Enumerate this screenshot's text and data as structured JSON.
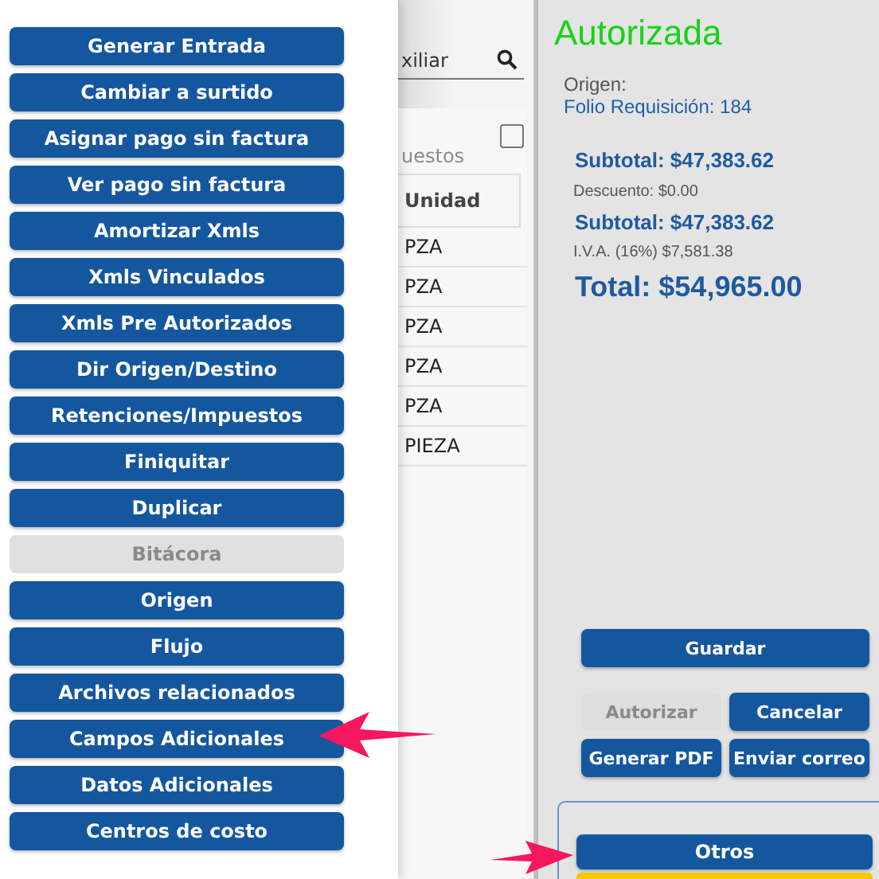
{
  "menu": [
    {
      "label": "Generar Entrada",
      "disabled": false
    },
    {
      "label": "Cambiar a surtido",
      "disabled": false
    },
    {
      "label": "Asignar pago sin factura",
      "disabled": false
    },
    {
      "label": "Ver pago sin factura",
      "disabled": false
    },
    {
      "label": "Amortizar Xmls",
      "disabled": false
    },
    {
      "label": "Xmls Vinculados",
      "disabled": false
    },
    {
      "label": "Xmls Pre Autorizados",
      "disabled": false
    },
    {
      "label": "Dir Origen/Destino",
      "disabled": false
    },
    {
      "label": "Retenciones/Impuestos",
      "disabled": false
    },
    {
      "label": "Finiquitar",
      "disabled": false
    },
    {
      "label": "Duplicar",
      "disabled": false
    },
    {
      "label": "Bitácora",
      "disabled": true
    },
    {
      "label": "Origen",
      "disabled": false
    },
    {
      "label": "Flujo",
      "disabled": false
    },
    {
      "label": "Archivos relacionados",
      "disabled": false
    },
    {
      "label": "Campos Adicionales",
      "disabled": false
    },
    {
      "label": "Datos Adicionales",
      "disabled": false
    },
    {
      "label": "Centros de costo",
      "disabled": false
    }
  ],
  "search": {
    "value": "xiliar"
  },
  "table": {
    "section_label": "uestos",
    "checked": false,
    "columns": [
      "Unidad"
    ],
    "rows": [
      [
        "PZA"
      ],
      [
        "PZA"
      ],
      [
        "PZA"
      ],
      [
        "PZA"
      ],
      [
        "PZA"
      ],
      [
        "PIEZA"
      ]
    ]
  },
  "order": {
    "status": "Autorizada",
    "origin_label": "Origen:",
    "folio": "Folio Requisición: 184",
    "subtotal": "Subtotal: $47,383.62",
    "discount": "Descuento: $0.00",
    "subtotal_2": "Subtotal: $47,383.62",
    "iva": "I.V.A. (16%) $7,581.38",
    "total": "Total: $54,965.00"
  },
  "actions": [
    {
      "label": "Guardar",
      "disabled": false,
      "kind": "wide"
    },
    {
      "label": "Autorizar",
      "disabled": true,
      "kind": "half"
    },
    {
      "label": "Cancelar",
      "disabled": false,
      "kind": "half"
    },
    {
      "label": "Generar PDF",
      "disabled": false,
      "kind": "half"
    },
    {
      "label": "Enviar correo",
      "disabled": false,
      "kind": "half"
    }
  ],
  "otros": {
    "label": "Otros"
  }
}
